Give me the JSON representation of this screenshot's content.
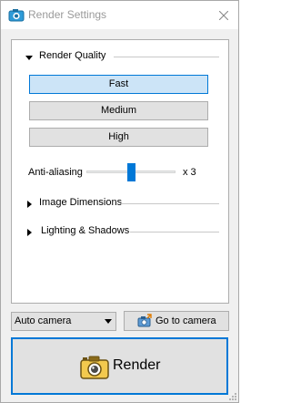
{
  "window": {
    "title": "Render Settings"
  },
  "render_quality": {
    "header": "Render Quality",
    "expanded": true,
    "options": [
      {
        "label": "Fast",
        "selected": true
      },
      {
        "label": "Medium",
        "selected": false
      },
      {
        "label": "High",
        "selected": false
      }
    ]
  },
  "antialiasing": {
    "label": "Anti-aliasing",
    "value_text": "x 3",
    "slider_level": 0.5
  },
  "sections": {
    "image_dimensions": {
      "header": "Image Dimensions",
      "expanded": false
    },
    "lighting_shadows": {
      "header": "Lighting & Shadows",
      "expanded": false
    }
  },
  "camera": {
    "selected": "Auto camera",
    "goto_label": "Go to camera"
  },
  "render_button": {
    "label": "Render"
  },
  "colors": {
    "accent": "#0078d7",
    "selected_fill": "#cce4f7",
    "button_fill": "#e1e1e1"
  },
  "icons": [
    "render-settings-app-icon",
    "close-icon",
    "expand-arrow-icon",
    "collapse-arrow-icon",
    "chevron-down-icon",
    "camera-goto-icon",
    "camera-icon",
    "resize-grip-icon"
  ]
}
